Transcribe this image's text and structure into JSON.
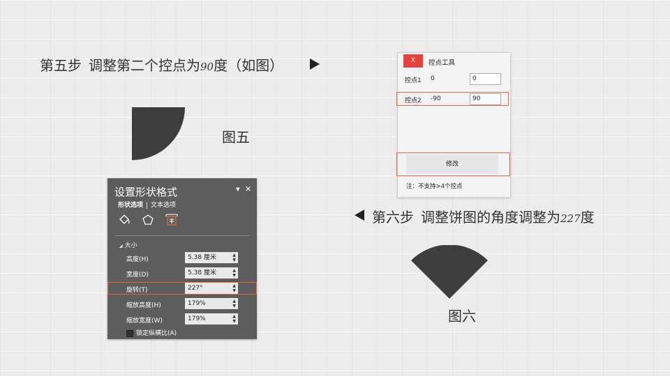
{
  "step5": {
    "prefix": "第五步",
    "text": "调整第二个控点为",
    "value": "90",
    "suffix": "度（如图）"
  },
  "step6": {
    "prefix": "第六步",
    "text": "调整饼图的角度调整为",
    "value": "227",
    "suffix": "度"
  },
  "figure5_label": "图五",
  "figure6_label": "图六",
  "shape_color": "#3d3d3d",
  "accent_highlight": "#e8643c",
  "tool_window": {
    "close_label": "X",
    "title": "控点工具",
    "rows": [
      {
        "label": "控点1",
        "value": "0",
        "input": "0"
      },
      {
        "label": "控点2",
        "value": "-90",
        "input": "90"
      }
    ],
    "modify_button": "修改",
    "note": "注：不支持>4个控点"
  },
  "format_pane": {
    "title": "设置形状格式",
    "dropdown_icon": "▾",
    "close_icon": "✕",
    "tabs": {
      "shape_options": "形状选项",
      "text_options": "文本选项"
    },
    "icons": [
      "fill-line-icon",
      "effects-pentagon-icon",
      "size-properties-icon"
    ],
    "section_title": "大小",
    "section_arrow": "◢",
    "fields": [
      {
        "label": "高度(H)",
        "value": "5.38 厘米"
      },
      {
        "label": "宽度(D)",
        "value": "5.38 厘米"
      },
      {
        "label": "旋转(T)",
        "value": "227°"
      },
      {
        "label": "缩放高度(H)",
        "value": "179%"
      },
      {
        "label": "缩放宽度(W)",
        "value": "179%"
      }
    ],
    "lock_label": "锁定纵横比(A)"
  }
}
